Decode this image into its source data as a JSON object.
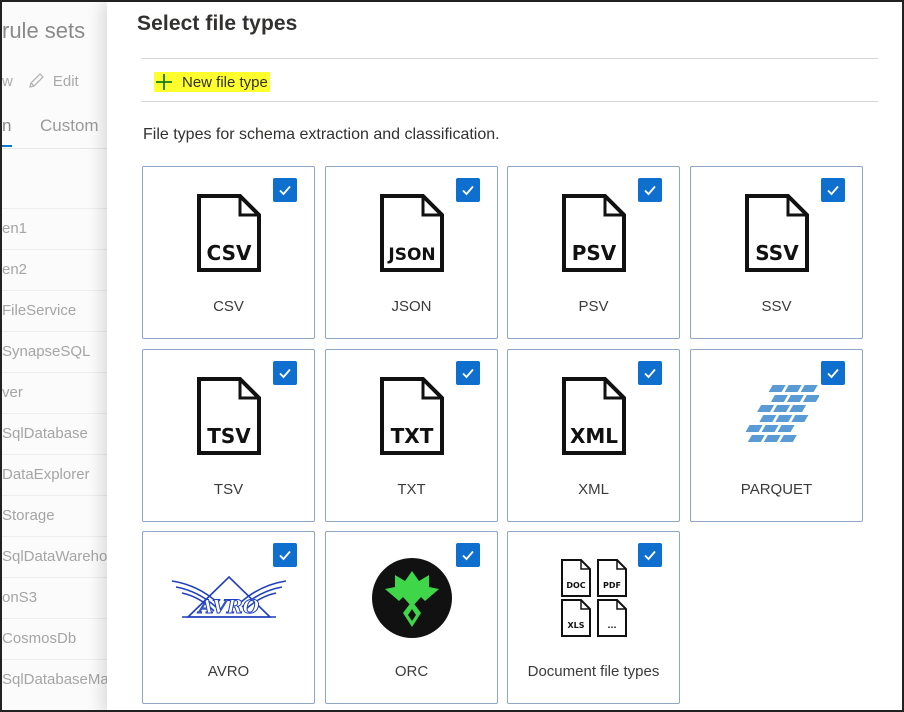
{
  "background": {
    "title": "rule sets",
    "toolbar": {
      "new_fragment": "w",
      "edit_label": "Edit"
    },
    "tabs": {
      "active_fragment": "n",
      "custom_label": "Custom"
    },
    "rows": [
      "en1",
      "en2",
      "FileService",
      "SynapseSQL",
      "ver",
      "SqlDatabase",
      "DataExplorer",
      "Storage",
      "SqlDataWareho",
      "onS3",
      "CosmosDb",
      "SqlDatabaseMa"
    ]
  },
  "panel": {
    "title": "Select file types",
    "new_file_type_label": "New file type",
    "description": "File types for schema extraction and classification."
  },
  "file_types": [
    {
      "label": "CSV",
      "icon_text": "CSV",
      "icon": "csv-file-icon",
      "checked": true
    },
    {
      "label": "JSON",
      "icon_text": "JSON",
      "icon": "json-file-icon",
      "checked": true
    },
    {
      "label": "PSV",
      "icon_text": "PSV",
      "icon": "psv-file-icon",
      "checked": true
    },
    {
      "label": "SSV",
      "icon_text": "SSV",
      "icon": "ssv-file-icon",
      "checked": true
    },
    {
      "label": "TSV",
      "icon_text": "TSV",
      "icon": "tsv-file-icon",
      "checked": true
    },
    {
      "label": "TXT",
      "icon_text": "TXT",
      "icon": "txt-file-icon",
      "checked": true
    },
    {
      "label": "XML",
      "icon_text": "XML",
      "icon": "xml-file-icon",
      "checked": true
    },
    {
      "label": "PARQUET",
      "icon": "parquet-logo-icon",
      "checked": true
    },
    {
      "label": "AVRO",
      "icon": "avro-logo-icon",
      "logo_text": "AVRO",
      "checked": true
    },
    {
      "label": "ORC",
      "icon": "orc-logo-icon",
      "checked": true
    },
    {
      "label": "Document file types",
      "icon": "document-files-icon",
      "doc_labels": [
        "DOC",
        "PDF",
        "XLS",
        "..."
      ],
      "checked": true
    }
  ],
  "colors": {
    "accent": "#0f6fce",
    "highlight": "#ffff2e",
    "card_border": "#8fa6c4",
    "parquet_blue": "#5b9bd5",
    "avro_blue": "#1f3fbf",
    "orc_green": "#3fd64a"
  }
}
